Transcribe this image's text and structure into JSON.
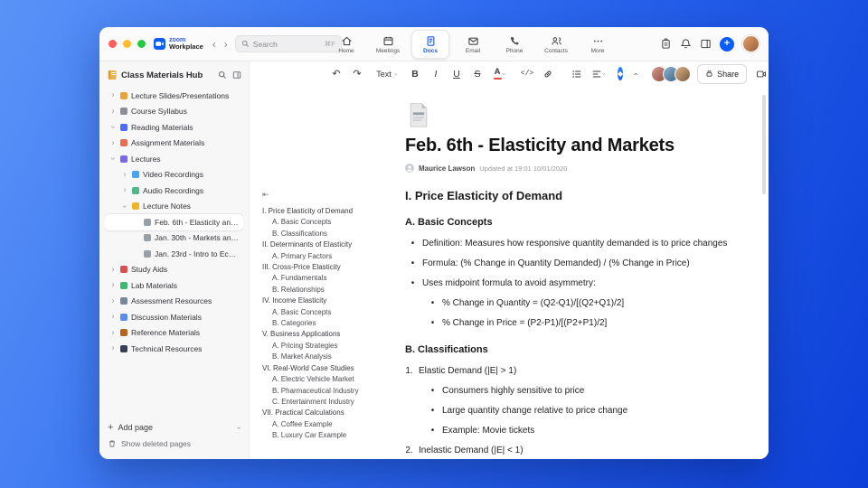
{
  "colors": {
    "accent": "#0b5cff",
    "selection_bg": "#ffffff",
    "window_bg": "#ffffff"
  },
  "titlebar": {
    "brand_top": "zoom",
    "brand_bottom": "Workplace",
    "search_placeholder": "Search",
    "search_shortcut": "⌘F",
    "tabs": [
      {
        "label": "Home",
        "icon": "home-icon",
        "active": false
      },
      {
        "label": "Meetings",
        "icon": "calendar-icon",
        "active": false
      },
      {
        "label": "Docs",
        "icon": "doc-icon",
        "active": true
      },
      {
        "label": "Email",
        "icon": "mail-icon",
        "active": false
      },
      {
        "label": "Phone",
        "icon": "phone-icon",
        "active": false
      },
      {
        "label": "Contacts",
        "icon": "contacts-icon",
        "active": false
      },
      {
        "label": "More",
        "icon": "more-icon",
        "active": false
      }
    ],
    "right_icons": [
      "clipboard-icon",
      "bell-icon",
      "side-panel-icon",
      "plus-button",
      "user-avatar"
    ]
  },
  "sidebar": {
    "title": "Class Materials Hub",
    "header_icons": [
      "notebook-icon",
      "search-icon",
      "panel-icon"
    ],
    "items": [
      {
        "label": "Lecture Slides/Presentations",
        "level": 0,
        "chevron": "right",
        "color": "#e8a33d",
        "selected": false
      },
      {
        "label": "Course Syllabus",
        "level": 0,
        "chevron": "right",
        "color": "#8a8f98",
        "selected": false
      },
      {
        "label": "Reading Materials",
        "level": 0,
        "chevron": "down",
        "color": "#4a6cf7",
        "selected": false
      },
      {
        "label": "Assignment Materials",
        "level": 0,
        "chevron": "right",
        "color": "#e86c4f",
        "selected": false
      },
      {
        "label": "Lectures",
        "level": 0,
        "chevron": "down",
        "color": "#7a67ee",
        "selected": false
      },
      {
        "label": "Video Recordings",
        "level": 1,
        "chevron": "right",
        "color": "#4aa3f0",
        "selected": false
      },
      {
        "label": "Audio Recordings",
        "level": 1,
        "chevron": "right",
        "color": "#52b788",
        "selected": false
      },
      {
        "label": "Lecture Notes",
        "level": 1,
        "chevron": "down",
        "color": "#f0b429",
        "selected": false
      },
      {
        "label": "Feb. 6th - Elasticity and M...",
        "level": 2,
        "chevron": "none",
        "color": "#9aa0a8",
        "selected": true
      },
      {
        "label": "Jan. 30th - Markets and P...",
        "level": 2,
        "chevron": "none",
        "color": "#9aa0a8",
        "selected": false
      },
      {
        "label": "Jan. 23rd - Intro to Econo...",
        "level": 2,
        "chevron": "none",
        "color": "#9aa0a8",
        "selected": false
      },
      {
        "label": "Study Aids",
        "level": 0,
        "chevron": "right",
        "color": "#d94f4f",
        "selected": false
      },
      {
        "label": "Lab Materials",
        "level": 0,
        "chevron": "right",
        "color": "#3dba6f",
        "selected": false
      },
      {
        "label": "Assessment Resources",
        "level": 0,
        "chevron": "right",
        "color": "#7a8699",
        "selected": false
      },
      {
        "label": "Discussion Materials",
        "level": 0,
        "chevron": "right",
        "color": "#5b8def",
        "selected": false
      },
      {
        "label": "Reference Materials",
        "level": 0,
        "chevron": "right",
        "color": "#b5651d",
        "selected": false
      },
      {
        "label": "Technical Resources",
        "level": 0,
        "chevron": "right",
        "color": "#374151",
        "selected": false
      }
    ],
    "footer": {
      "add_page": "Add page",
      "show_deleted": "Show deleted pages"
    }
  },
  "doc_toolbar": {
    "text_style": "Text",
    "bold": "B",
    "italic": "I",
    "underline": "U",
    "strike": "S",
    "color_letter": "A",
    "code": "</>",
    "share_label": "Share",
    "collaborator_count": 3,
    "icons": [
      "undo-icon",
      "redo-icon",
      "text-style-dropdown",
      "bold",
      "italic",
      "underline",
      "strikethrough",
      "font-color",
      "code-icon",
      "link-icon",
      "bullet-list-icon",
      "align-icon",
      "ai-companion-button",
      "collapse-toolbar-chevron",
      "collaborator-avatars",
      "share-button",
      "video-icon",
      "comments-icon",
      "web-icon",
      "more-options-icon"
    ]
  },
  "document": {
    "title": "Feb. 6th - Elasticity and Markets",
    "author": "Maurice Lawson",
    "updated": "Updated at 19:01 10/01/2020",
    "outline": [
      {
        "text": "I. Price Elasticity of Demand",
        "level": 0
      },
      {
        "text": "A. Basic Concepts",
        "level": 1
      },
      {
        "text": "B. Classifications",
        "level": 1
      },
      {
        "text": "II. Determinants of Elasticity",
        "level": 0
      },
      {
        "text": "A. Primary Factors",
        "level": 1
      },
      {
        "text": "III. Cross-Price Elasticity",
        "level": 0
      },
      {
        "text": "A. Fundamentals",
        "level": 1
      },
      {
        "text": "B. Relationships",
        "level": 1
      },
      {
        "text": "IV. Income Elasticity",
        "level": 0
      },
      {
        "text": "A. Basic Concepts",
        "level": 1
      },
      {
        "text": "B. Categories",
        "level": 1
      },
      {
        "text": "V. Business Applications",
        "level": 0
      },
      {
        "text": "A. Pricing Strategies",
        "level": 1
      },
      {
        "text": "B. Market Analysis",
        "level": 1
      },
      {
        "text": "VI. Real-World Case Studies",
        "level": 0
      },
      {
        "text": "A. Electric Vehicle Market",
        "level": 1
      },
      {
        "text": "B. Pharmaceutical Industry",
        "level": 1
      },
      {
        "text": "C. Entertainment Industry",
        "level": 1
      },
      {
        "text": "VII. Practical Calculations",
        "level": 0
      },
      {
        "text": "A. Coffee Example",
        "level": 1
      },
      {
        "text": "B. Luxury Car Example",
        "level": 1
      }
    ],
    "blocks": [
      {
        "type": "h2",
        "text": "I. Price Elasticity of Demand"
      },
      {
        "type": "h3",
        "text": "A. Basic Concepts"
      },
      {
        "type": "bullet",
        "level": 0,
        "text": "Definition: Measures how responsive quantity demanded is to price changes"
      },
      {
        "type": "bullet",
        "level": 0,
        "text": "Formula: (% Change in Quantity Demanded) / (% Change in Price)"
      },
      {
        "type": "bullet",
        "level": 0,
        "text": "Uses midpoint formula to avoid asymmetry:"
      },
      {
        "type": "bullet",
        "level": 1,
        "text": "% Change in Quantity = (Q2-Q1)/[(Q2+Q1)/2]"
      },
      {
        "type": "bullet",
        "level": 1,
        "text": "% Change in Price = (P2-P1)/[(P2+P1)/2]"
      },
      {
        "type": "h3",
        "text": "B. Classifications"
      },
      {
        "type": "num",
        "n": "1.",
        "level": 0,
        "text": "Elastic Demand (|E| > 1)"
      },
      {
        "type": "bullet",
        "level": 1,
        "text": "Consumers highly sensitive to price"
      },
      {
        "type": "bullet",
        "level": 1,
        "text": "Large quantity change relative to price change"
      },
      {
        "type": "bullet",
        "level": 1,
        "text": "Example: Movie tickets"
      },
      {
        "type": "num",
        "n": "2.",
        "level": 0,
        "text": "Inelastic Demand (|E| < 1)"
      }
    ]
  }
}
